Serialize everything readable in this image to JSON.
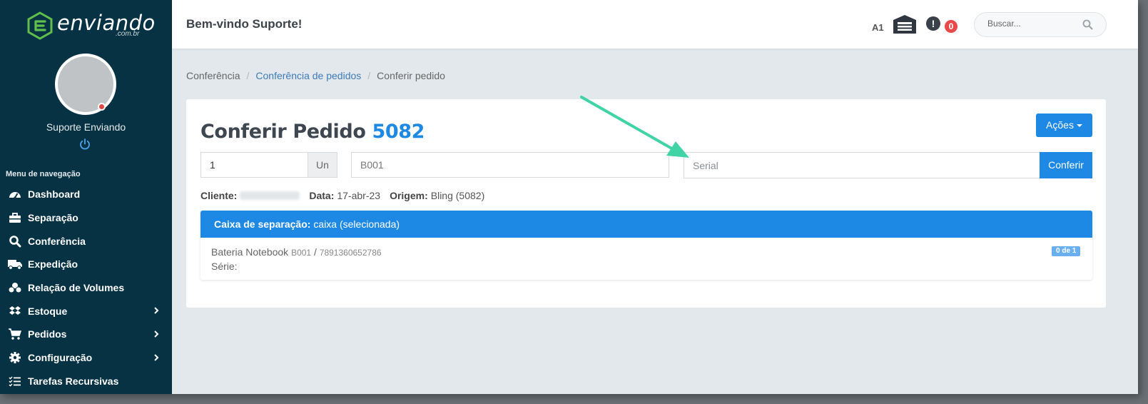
{
  "brand": {
    "name": "enviando",
    "domain": ".com.br",
    "logo_icon": "box-e-logo"
  },
  "user": {
    "name": "Suporte Enviando",
    "status_color": "#e04848"
  },
  "sidebar": {
    "section_title": "Menu de navegação",
    "items": [
      {
        "label": "Dashboard",
        "icon": "dashboard-icon",
        "has_children": false
      },
      {
        "label": "Separação",
        "icon": "toolbox-icon",
        "has_children": false
      },
      {
        "label": "Conferência",
        "icon": "search-icon",
        "has_children": false
      },
      {
        "label": "Expedição",
        "icon": "truck-icon",
        "has_children": false
      },
      {
        "label": "Relação de Volumes",
        "icon": "boxes-icon",
        "has_children": false
      },
      {
        "label": "Estoque",
        "icon": "dropbox-icon",
        "has_children": true
      },
      {
        "label": "Pedidos",
        "icon": "cart-icon",
        "has_children": true
      },
      {
        "label": "Configuração",
        "icon": "gear-icon",
        "has_children": true
      },
      {
        "label": "Tarefas Recursivas",
        "icon": "tasks-icon",
        "has_children": false
      }
    ]
  },
  "header": {
    "welcome": "Bem-vindo Suporte!",
    "warehouse_code": "A1",
    "alert_count": "0",
    "search_placeholder": "Buscar..."
  },
  "breadcrumb": [
    "Conferência",
    "Conferência de pedidos",
    "Conferir pedido"
  ],
  "order": {
    "title": "Conferir Pedido",
    "number": "5082",
    "actions_label": "Ações",
    "quantity_value": "1",
    "unit_label": "Un",
    "sku_value": "B001",
    "serial_placeholder": "Serial",
    "check_label": "Conferir",
    "meta": {
      "client_label": "Cliente:",
      "date_label": "Data:",
      "date_value": "17-abr-23",
      "origin_label": "Origem:",
      "origin_value": "Bling (5082)"
    },
    "box": {
      "label": "Caixa de separação:",
      "value": "caixa (selecionada)"
    },
    "item": {
      "name": "Bateria Notebook",
      "sku": "B001",
      "separator": "/",
      "ean": "7891360652786",
      "serial_label": "Série:",
      "progress": "0 de 1"
    }
  },
  "colors": {
    "sidebar_bg": "#063243",
    "accent": "#1e88e5",
    "arrow": "#3fd3a6",
    "badge_red": "#e84a4a"
  }
}
